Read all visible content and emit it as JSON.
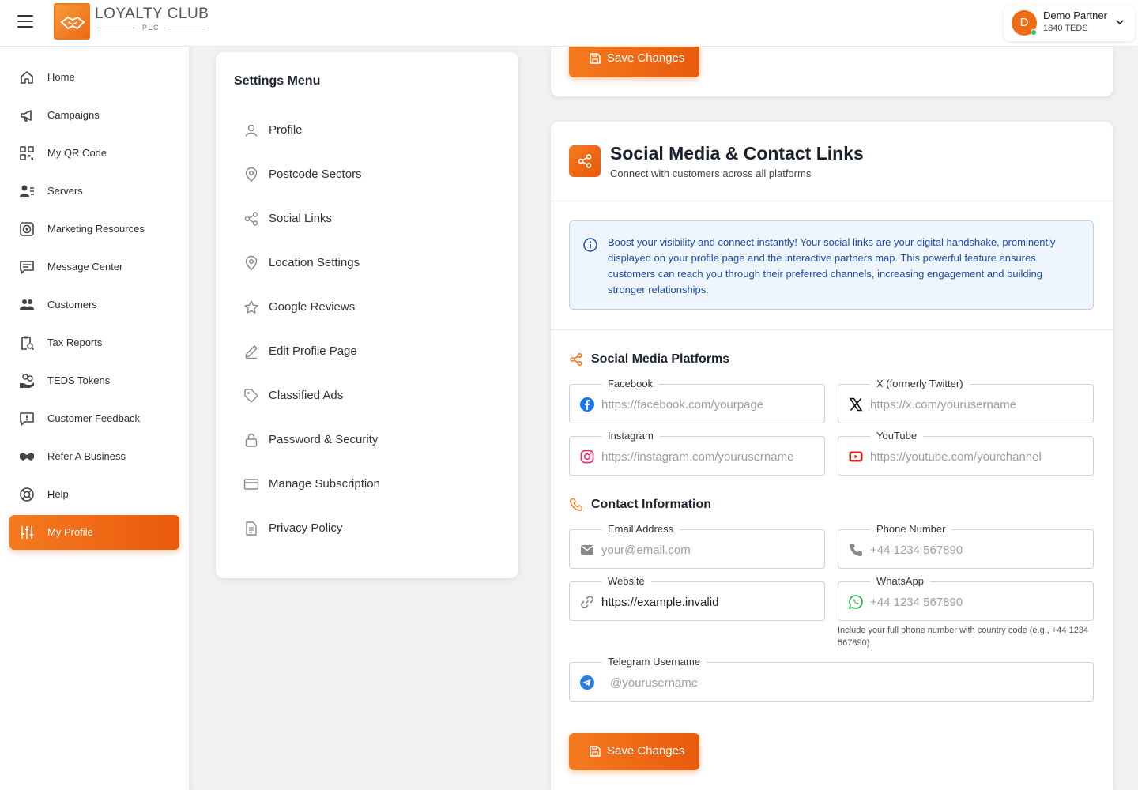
{
  "brand": {
    "name": "LOYALTY CLUB",
    "sub": "PLC"
  },
  "user": {
    "initial": "D",
    "name": "Demo Partner",
    "balance": "1840 TEDS"
  },
  "sidebar": {
    "items": [
      {
        "label": "Home",
        "icon": "home-icon"
      },
      {
        "label": "Campaigns",
        "icon": "megaphone-icon"
      },
      {
        "label": "My QR Code",
        "icon": "qr-code-icon"
      },
      {
        "label": "Servers",
        "icon": "servers-icon"
      },
      {
        "label": "Marketing Resources",
        "icon": "target-icon"
      },
      {
        "label": "Message Center",
        "icon": "message-icon"
      },
      {
        "label": "Customers",
        "icon": "users-icon"
      },
      {
        "label": "Tax Reports",
        "icon": "clipboard-search-icon"
      },
      {
        "label": "TEDS Tokens",
        "icon": "coins-hand-icon"
      },
      {
        "label": "Customer Feedback",
        "icon": "feedback-icon"
      },
      {
        "label": "Refer A Business",
        "icon": "handshake-icon"
      },
      {
        "label": "Help",
        "icon": "lifebuoy-icon"
      },
      {
        "label": "My Profile",
        "icon": "sliders-icon",
        "active": true
      }
    ]
  },
  "settings_menu": {
    "title": "Settings Menu",
    "items": [
      {
        "label": "Profile",
        "icon": "user-icon"
      },
      {
        "label": "Postcode Sectors",
        "icon": "map-pin-icon"
      },
      {
        "label": "Social Links",
        "icon": "share-icon"
      },
      {
        "label": "Location Settings",
        "icon": "map-pin-icon"
      },
      {
        "label": "Google Reviews",
        "icon": "star-icon"
      },
      {
        "label": "Edit Profile Page",
        "icon": "pencil-icon"
      },
      {
        "label": "Classified Ads",
        "icon": "tag-icon"
      },
      {
        "label": "Password & Security",
        "icon": "lock-icon"
      },
      {
        "label": "Manage Subscription",
        "icon": "credit-card-icon"
      },
      {
        "label": "Privacy Policy",
        "icon": "document-icon"
      }
    ]
  },
  "save_label": "Save Changes",
  "social": {
    "title": "Social Media & Contact Links",
    "subtitle": "Connect with customers across all platforms",
    "info": "Boost your visibility and connect instantly! Your social links are your digital handshake, prominently displayed on your profile page and the interactive partners map. This powerful feature ensures customers can reach you through their preferred channels, increasing engagement and building stronger relationships.",
    "platforms_title": "Social Media Platforms",
    "contact_title": "Contact Information",
    "fields": {
      "facebook": {
        "label": "Facebook",
        "placeholder": "https://facebook.com/yourpage",
        "value": ""
      },
      "x": {
        "label": "X (formerly Twitter)",
        "placeholder": "https://x.com/yourusername",
        "value": ""
      },
      "instagram": {
        "label": "Instagram",
        "placeholder": "https://instagram.com/yourusername",
        "value": ""
      },
      "youtube": {
        "label": "YouTube",
        "placeholder": "https://youtube.com/yourchannel",
        "value": ""
      },
      "email": {
        "label": "Email Address",
        "placeholder": "your@email.com",
        "value": ""
      },
      "phone": {
        "label": "Phone Number",
        "placeholder": "+44 1234 567890",
        "value": ""
      },
      "website": {
        "label": "Website",
        "placeholder": "",
        "value": "https://example.invalid"
      },
      "whatsapp": {
        "label": "WhatsApp",
        "placeholder": "+44 1234 567890",
        "value": ""
      },
      "telegram": {
        "label": "Telegram Username",
        "placeholder": "@yourusername",
        "value": ""
      }
    },
    "whatsapp_help": "Include your full phone number with country code (e.g., +44 1234 567890)"
  },
  "colors": {
    "accent": "#f47a1f",
    "accent_dark": "#ea5a0c",
    "info_bg": "#eef5fd",
    "info_text": "#1d4aa8"
  }
}
